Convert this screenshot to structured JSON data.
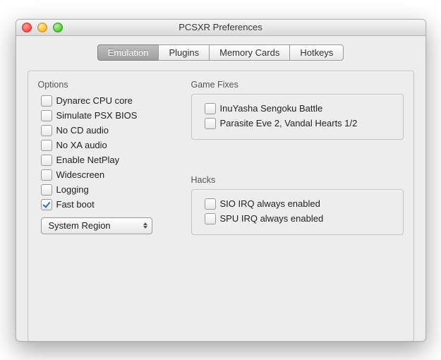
{
  "window": {
    "title": "PCSXR Preferences"
  },
  "tabs": [
    {
      "label": "Emulation",
      "selected": true
    },
    {
      "label": "Plugins",
      "selected": false
    },
    {
      "label": "Memory Cards",
      "selected": false
    },
    {
      "label": "Hotkeys",
      "selected": false
    }
  ],
  "options": {
    "title": "Options",
    "items": [
      {
        "label": "Dynarec CPU core",
        "checked": false
      },
      {
        "label": "Simulate PSX BIOS",
        "checked": false
      },
      {
        "label": "No CD audio",
        "checked": false
      },
      {
        "label": "No XA audio",
        "checked": false
      },
      {
        "label": "Enable NetPlay",
        "checked": false
      },
      {
        "label": "Widescreen",
        "checked": false
      },
      {
        "label": "Logging",
        "checked": false
      },
      {
        "label": "Fast boot",
        "checked": true
      }
    ],
    "region_select": "System Region"
  },
  "gamefixes": {
    "title": "Game Fixes",
    "items": [
      {
        "label": "InuYasha Sengoku Battle",
        "checked": false
      },
      {
        "label": "Parasite Eve 2, Vandal Hearts 1/2",
        "checked": false
      }
    ]
  },
  "hacks": {
    "title": "Hacks",
    "items": [
      {
        "label": "SIO IRQ always enabled",
        "checked": false
      },
      {
        "label": "SPU IRQ always enabled",
        "checked": false
      }
    ]
  }
}
